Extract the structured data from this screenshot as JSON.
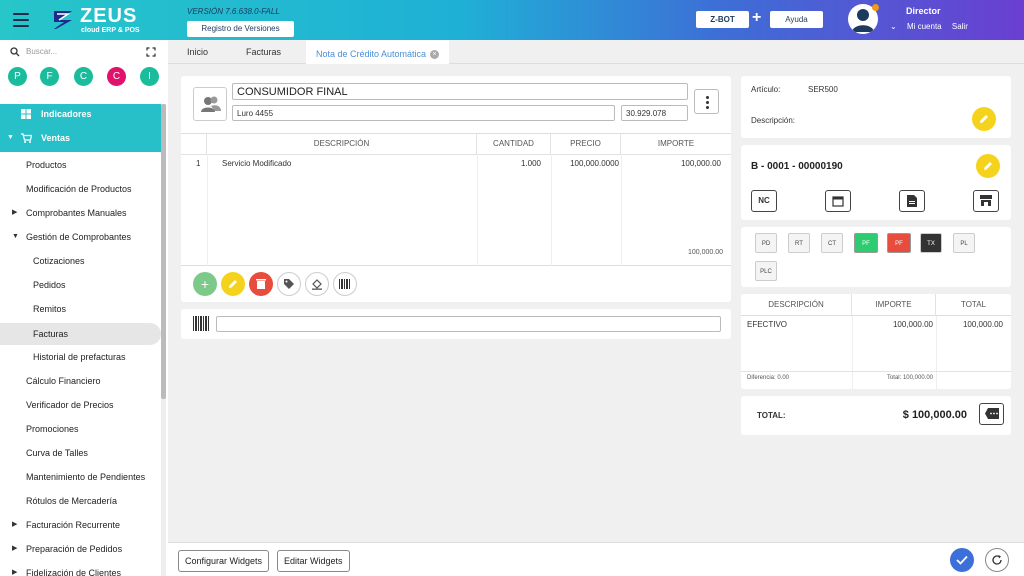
{
  "header": {
    "logo_title": "ZEUS",
    "logo_subtitle": "cloud ERP & POS",
    "version": "VERSIÓN 7.6.638.0-FALL",
    "registry_button": "Registro de Versiones",
    "zbot_button": "Z-BOT",
    "plus": "+",
    "help_button": "Ayuda",
    "user_name": "Director",
    "account_link": "Mi cuenta",
    "logout_link": "Salir",
    "gradient_start": "#26c6c9",
    "gradient_end": "#6a3fd1"
  },
  "sidebar": {
    "search_placeholder": "Buscar...",
    "quick_buttons": [
      "P",
      "F",
      "C",
      "C",
      "I"
    ],
    "items": [
      {
        "label": "Indicadores"
      },
      {
        "label": "Ventas"
      },
      {
        "label": "Productos"
      },
      {
        "label": "Modificación de Productos"
      },
      {
        "label": "Comprobantes Manuales"
      },
      {
        "label": "Gestión de Comprobantes"
      },
      {
        "label": "Cotizaciones"
      },
      {
        "label": "Pedidos"
      },
      {
        "label": "Remitos"
      },
      {
        "label": "Facturas"
      },
      {
        "label": "Historial de prefacturas"
      },
      {
        "label": "Cálculo Financiero"
      },
      {
        "label": "Verificador de Precios"
      },
      {
        "label": "Promociones"
      },
      {
        "label": "Curva de Talles"
      },
      {
        "label": "Mantenimiento de Pendientes"
      },
      {
        "label": "Rótulos de Mercadería"
      },
      {
        "label": "Facturación Recurrente"
      },
      {
        "label": "Preparación de Pedidos"
      },
      {
        "label": "Fidelización de Clientes"
      }
    ],
    "accent_color": "#27c0c8"
  },
  "tabs": [
    {
      "label": "Inicio"
    },
    {
      "label": "Facturas"
    },
    {
      "label": "Nota de Crédito Automática"
    }
  ],
  "client": {
    "name": "CONSUMIDOR FINAL",
    "address": "Luro 4455",
    "doc_number": "30.929.078"
  },
  "items_table": {
    "headers": [
      "DESCRIPCIÓN",
      "CANTIDAD",
      "PRECIO",
      "IMPORTE"
    ],
    "rows": [
      {
        "index": "1",
        "description": "Servicio Modificado",
        "quantity": "1.000",
        "price": "100,000.0000",
        "amount": "100,000.00"
      }
    ],
    "total": "100,000.00"
  },
  "article": {
    "label": "Artículo:",
    "code": "SER500",
    "description_label": "Descripción:"
  },
  "document": {
    "number": "B - 0001 - 00000190",
    "type_button": "NC"
  },
  "doc_buttons": [
    "PD",
    "RT",
    "CT",
    "PF",
    "PF",
    "TX",
    "PL",
    "PLC"
  ],
  "payments": {
    "headers": [
      "DESCRIPCIÓN",
      "IMPORTE",
      "TOTAL"
    ],
    "rows": [
      {
        "description": "EFECTIVO",
        "amount": "100,000.00",
        "total": "100,000.00"
      }
    ],
    "difference": "Diferencia: 0.00",
    "total_label": "Total: 100,000.00"
  },
  "totals": {
    "label": "TOTAL:",
    "value": "$ 100,000.00"
  },
  "footer": {
    "configure_button": "Configurar Widgets",
    "edit_button": "Editar Widgets"
  }
}
